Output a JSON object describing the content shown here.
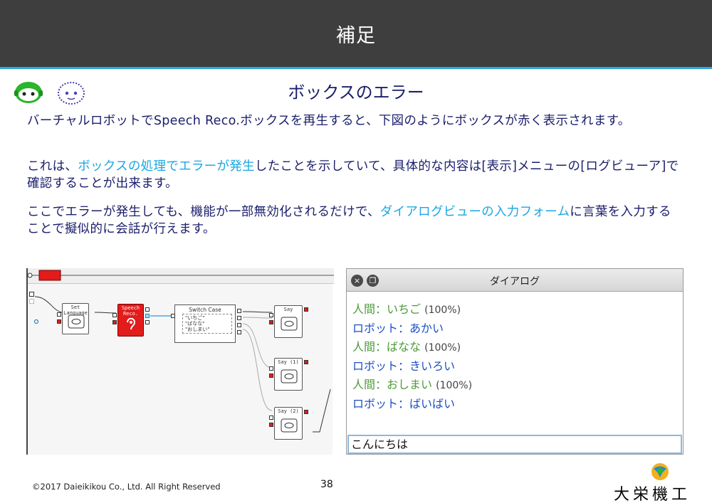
{
  "header": {
    "title": "補足"
  },
  "subtitle": "ボックスのエラー",
  "paragraphs": {
    "p1": "バーチャルロボットでSpeech Reco.ボックスを再生すると、下図のようにボックスが赤く表示されます。",
    "p2_before": "これは、",
    "p2_highlight": "ボックスの処理でエラーが発生",
    "p2_after": "したことを示していて、具体的な内容は[表示]メニューの[ログビューア]で確認することが出来ます。",
    "p3_before": "ここでエラーが発生しても、機能が一部無効化されるだけで、",
    "p3_highlight": "ダイアログビューの入力フォーム",
    "p3_after": "に言葉を入力することで擬似的に会話が行えます。"
  },
  "flow": {
    "top_box_label": "",
    "set_language_label": "Set Language",
    "speech_reco_label": "Speech Reco.",
    "switch_case_title": "Switch Case",
    "switch_rows": [
      "\"いちご\"",
      "\"ばなな\"",
      "\"おしまい\""
    ],
    "say_label": "Say",
    "say1_label": "Say (1)",
    "say2_label": "Say (2)"
  },
  "dialog": {
    "title": "ダイアログ",
    "lines": [
      {
        "text": "人間：いちご",
        "tag": "(100%)",
        "speaker": "human"
      },
      {
        "text": "ロボット：あかい",
        "tag": "",
        "speaker": "robot"
      },
      {
        "text": "人間：ばなな",
        "tag": "(100%)",
        "speaker": "human"
      },
      {
        "text": "ロボット：きいろい",
        "tag": "",
        "speaker": "robot"
      },
      {
        "text": "人間：おしまい",
        "tag": "(100%)",
        "speaker": "human"
      },
      {
        "text": "ロボット：ばいばい",
        "tag": "",
        "speaker": "robot"
      }
    ],
    "input_value": "こんにちは"
  },
  "footer": {
    "copyright": "©2017 Daieikikou Co., Ltd. All Right Reserved",
    "page": "38",
    "company": "大栄機工"
  },
  "colors": {
    "header_bg": "#3e3e3e",
    "accent": "#28a6df",
    "text": "#1b1f6b",
    "highlight": "#1aa7e0",
    "error_red": "#e21b1b",
    "human_green": "#4d9a3a",
    "robot_blue": "#1c4fc4"
  },
  "icons": [
    "robot-face-green-icon",
    "robot-face-outline-icon",
    "close-icon",
    "restore-icon",
    "speaker-icon",
    "ear-icon",
    "company-logo-icon"
  ]
}
